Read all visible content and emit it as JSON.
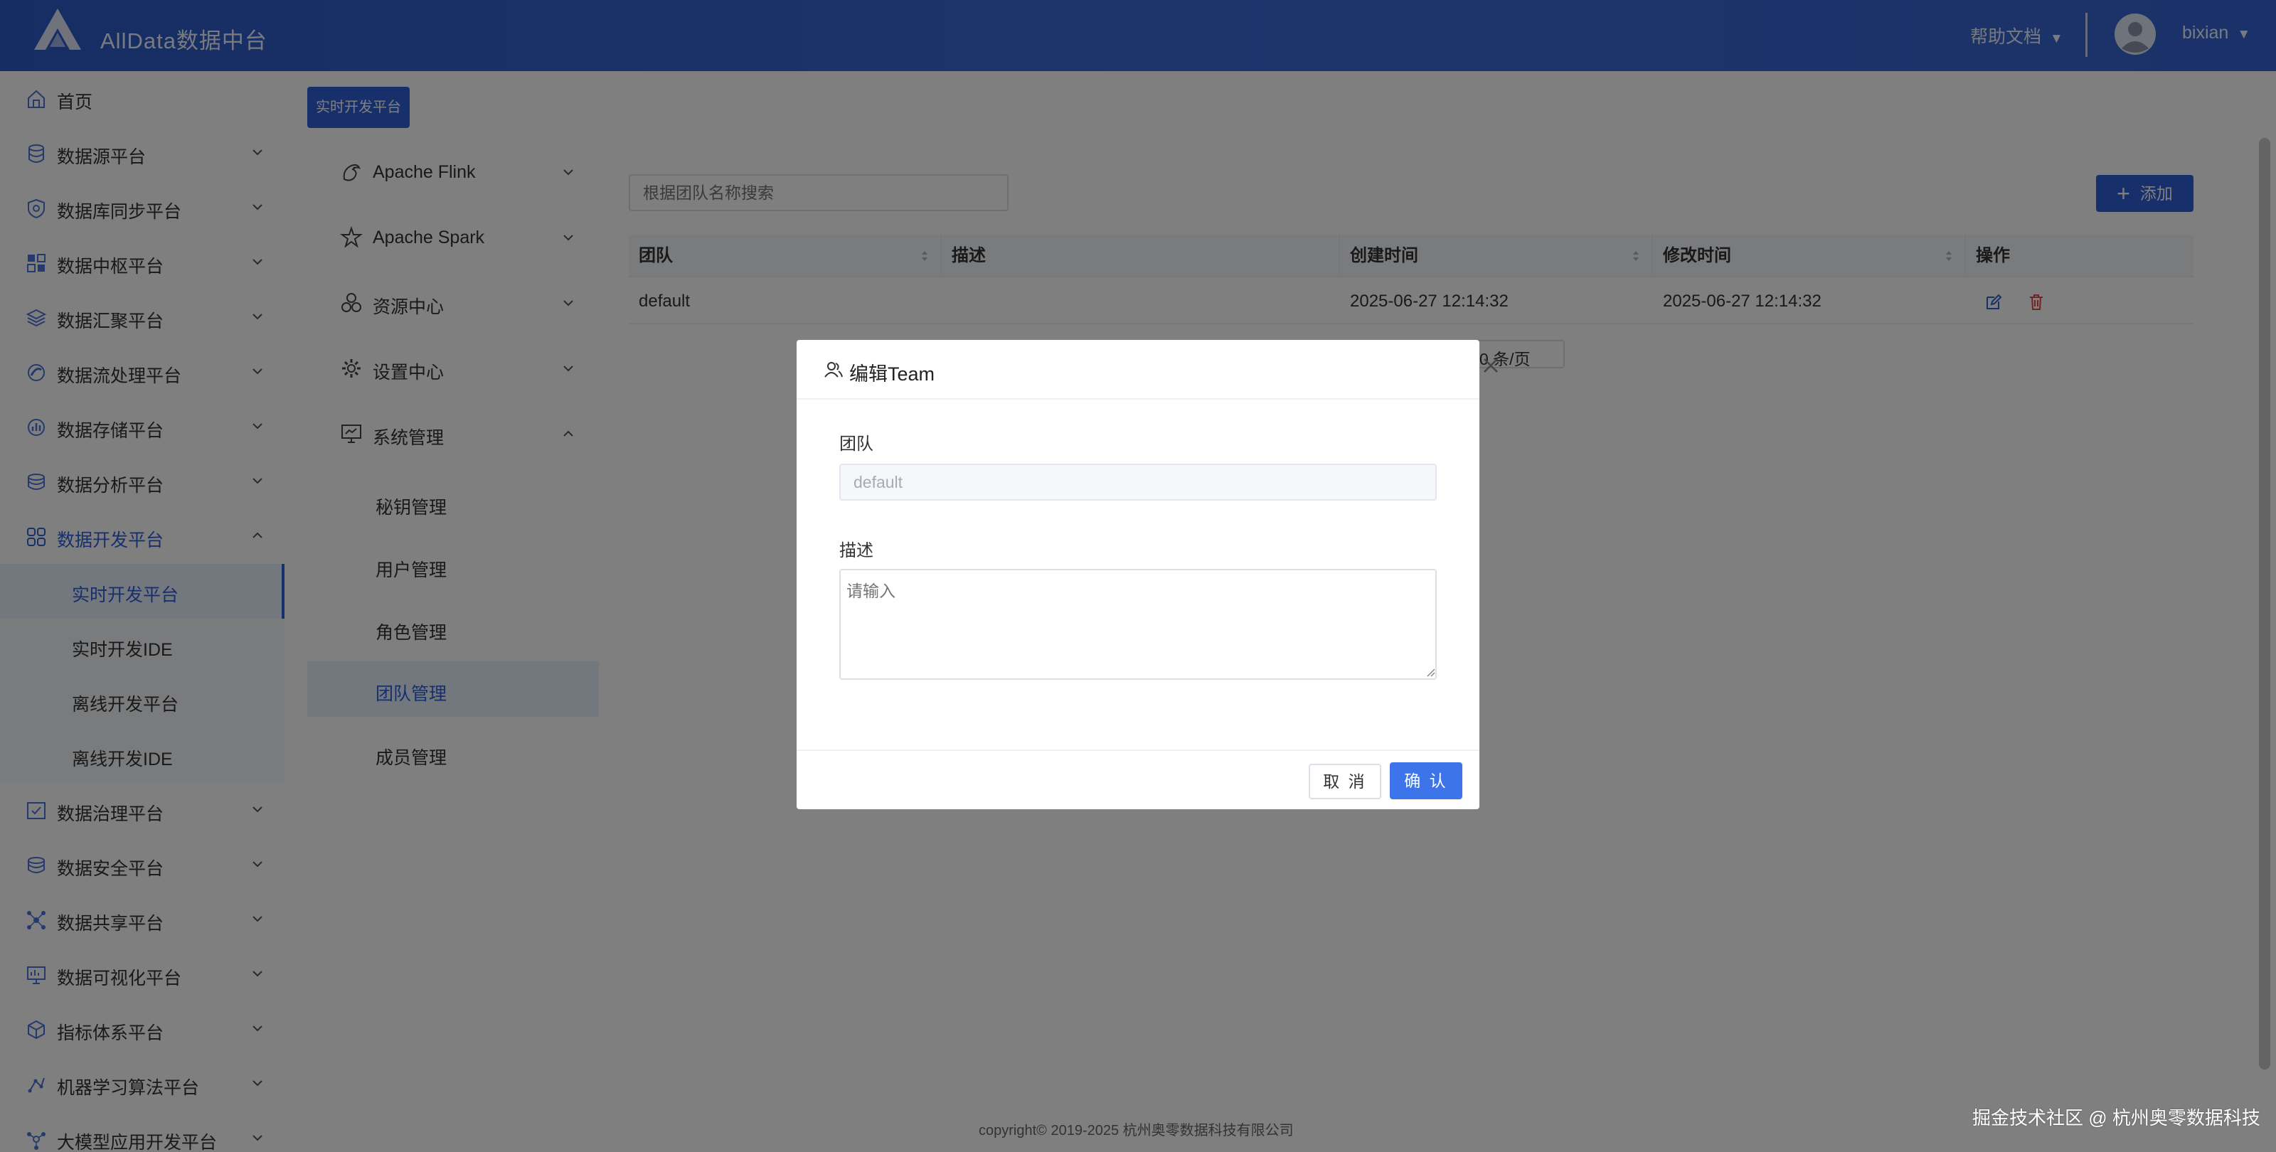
{
  "header": {
    "app_title": "AllData数据中台",
    "help_label": "帮助文档",
    "caret": "▼",
    "username": "bixian"
  },
  "sidebar": {
    "items": [
      {
        "label": "首页",
        "icon": "home-icon"
      },
      {
        "label": "数据源平台",
        "icon": "database-icon"
      },
      {
        "label": "数据库同步平台",
        "icon": "sync-shield-icon"
      },
      {
        "label": "数据中枢平台",
        "icon": "grid-icon"
      },
      {
        "label": "数据汇聚平台",
        "icon": "layers-icon"
      },
      {
        "label": "数据流处理平台",
        "icon": "stream-icon"
      },
      {
        "label": "数据存储平台",
        "icon": "storage-icon"
      },
      {
        "label": "数据分析平台",
        "icon": "analysis-icon"
      },
      {
        "label": "数据开发平台",
        "icon": "apps-icon"
      },
      {
        "label": "数据治理平台",
        "icon": "governance-icon"
      },
      {
        "label": "数据安全平台",
        "icon": "security-icon"
      },
      {
        "label": "数据共享平台",
        "icon": "share-icon"
      },
      {
        "label": "数据可视化平台",
        "icon": "monitor-icon"
      },
      {
        "label": "指标体系平台",
        "icon": "cube-icon"
      },
      {
        "label": "机器学习算法平台",
        "icon": "ml-icon"
      },
      {
        "label": "大模型应用开发平台",
        "icon": "llm-icon"
      }
    ],
    "sub_items": [
      {
        "label": "实时开发平台"
      },
      {
        "label": "实时开发IDE"
      },
      {
        "label": "离线开发平台"
      },
      {
        "label": "离线开发IDE"
      }
    ]
  },
  "breadcrumb_tag": "实时开发平台",
  "subnav": {
    "items": [
      {
        "label": "Apache Flink",
        "icon": "flink-icon"
      },
      {
        "label": "Apache Spark",
        "icon": "spark-icon"
      },
      {
        "label": "资源中心",
        "icon": "resource-icon"
      },
      {
        "label": "设置中心",
        "icon": "gear-icon"
      },
      {
        "label": "系统管理",
        "icon": "system-icon"
      }
    ],
    "children": [
      {
        "label": "秘钥管理"
      },
      {
        "label": "用户管理"
      },
      {
        "label": "角色管理"
      },
      {
        "label": "团队管理"
      },
      {
        "label": "成员管理"
      }
    ]
  },
  "toolbar": {
    "search_placeholder": "根据团队名称搜索",
    "add_label": "添加",
    "add_symbol": "+"
  },
  "table": {
    "columns": [
      "团队",
      "描述",
      "创建时间",
      "修改时间",
      "操作"
    ],
    "rows": [
      {
        "team": "default",
        "description": "",
        "created": "2025-06-27 12:14:32",
        "modified": "2025-06-27 12:14:32"
      }
    ]
  },
  "pagination": {
    "page_size_label": "0 条/页"
  },
  "modal": {
    "title": "编辑Team",
    "team_label": "团队",
    "team_value": "default",
    "desc_label": "描述",
    "desc_placeholder": "请输入",
    "cancel_label": "取 消",
    "confirm_label": "确 认"
  },
  "footer": {
    "copyright": "copyright© 2019-2025 杭州奥零数据科技有限公司",
    "watermark": "掘金技术社区 @ 杭州奥零数据科技"
  },
  "colors": {
    "primary": "#2f5ed6",
    "confirm": "#3e74ea",
    "delete": "#e04848"
  }
}
